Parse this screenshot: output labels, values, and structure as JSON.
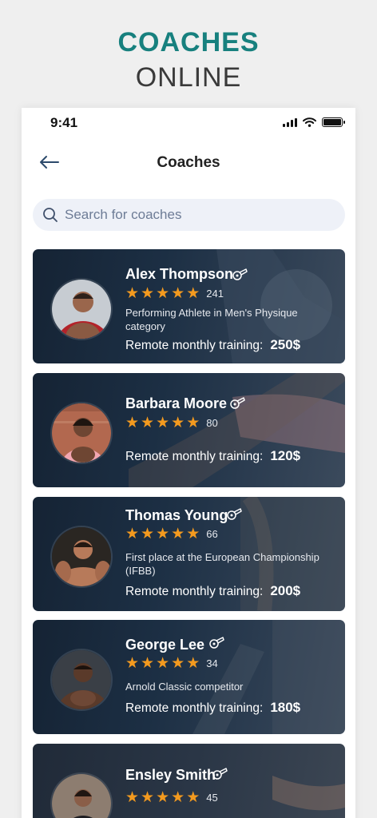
{
  "promo": {
    "line1": "COACHES",
    "line2": "ONLINE"
  },
  "status_bar": {
    "time": "9:41",
    "battery_level": 1.0
  },
  "header": {
    "title": "Coaches",
    "back_icon": "arrow-left-icon"
  },
  "search": {
    "placeholder": "Search for coaches",
    "icon": "search-icon"
  },
  "colors": {
    "accent": "#17807e",
    "star": "#f39a1f",
    "card_bg": "#1c2f44"
  },
  "coaches": [
    {
      "name": "Alex Thompson",
      "rating": 5,
      "reviews": "241",
      "description": "Performing Athlete in Men's Physique category",
      "price_label": "Remote monthly training:",
      "price": "250$"
    },
    {
      "name": "Barbara Moore",
      "rating": 5,
      "reviews": "80",
      "description": "",
      "price_label": "Remote monthly training:",
      "price": "120$"
    },
    {
      "name": "Thomas Young",
      "rating": 5,
      "reviews": "66",
      "description": "First place at the European Championship (IFBB)",
      "price_label": "Remote monthly training:",
      "price": "200$"
    },
    {
      "name": "George Lee",
      "rating": 5,
      "reviews": "34",
      "description": "Arnold Classic competitor",
      "price_label": "Remote monthly training:",
      "price": "180$"
    },
    {
      "name": "Ensley Smith",
      "rating": 5,
      "reviews": "45",
      "description": "",
      "price_label": "",
      "price": ""
    }
  ]
}
